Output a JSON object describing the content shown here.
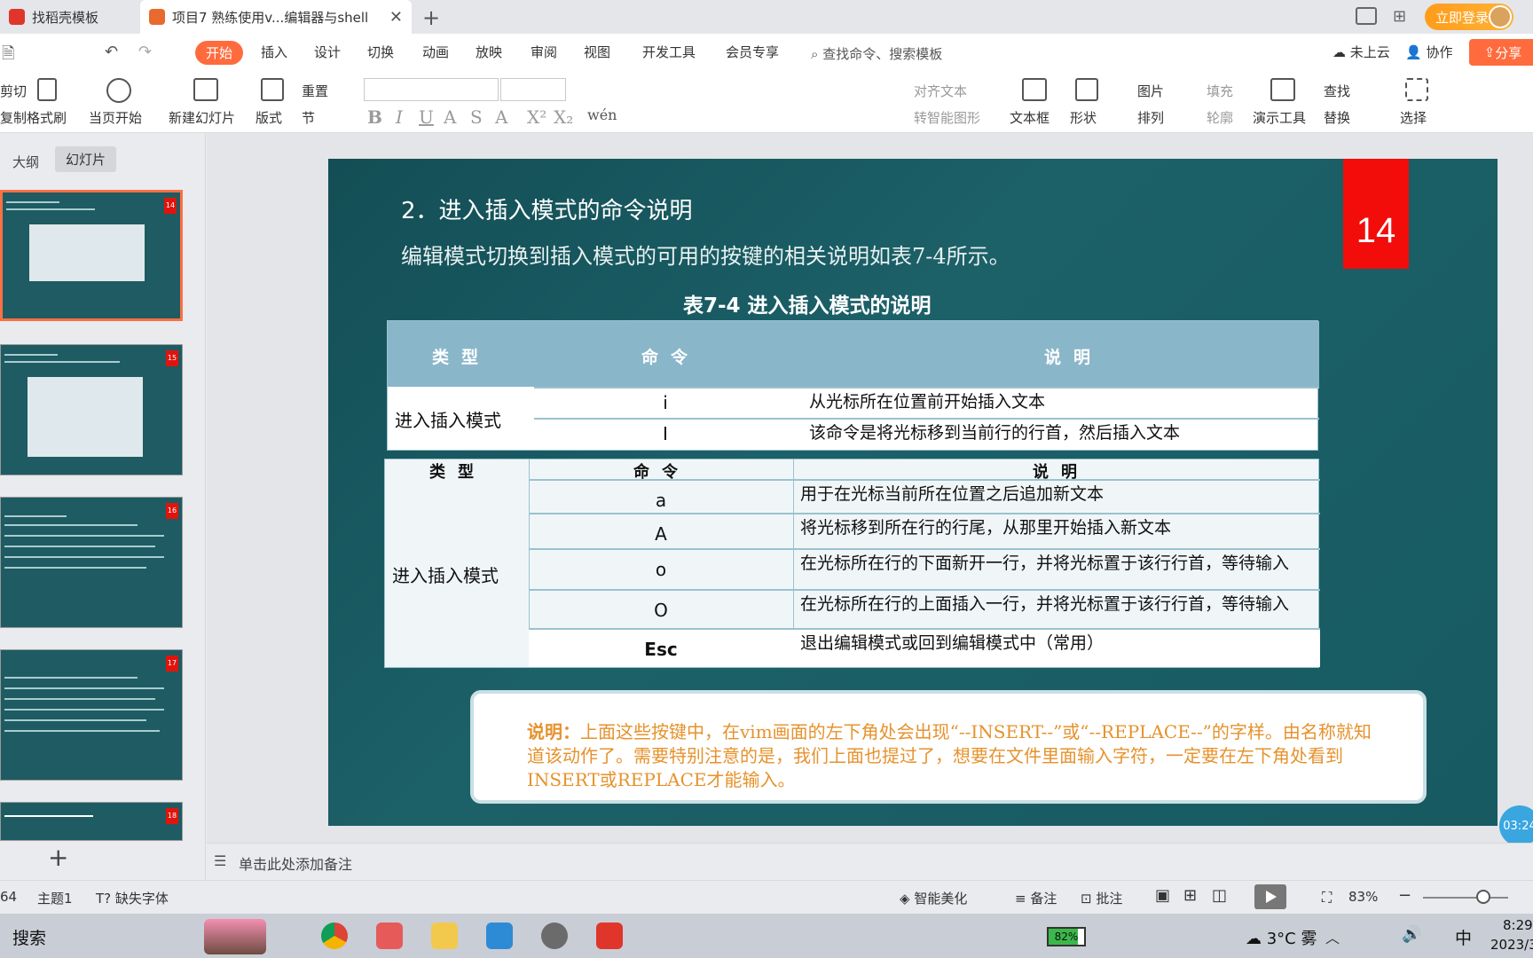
{
  "tabs": [
    {
      "label": "找稻壳模板"
    },
    {
      "label": "项目7 熟练使用v...编辑器与shell"
    }
  ],
  "header": {
    "login": "立即登录"
  },
  "menu": {
    "items": [
      "开始",
      "插入",
      "设计",
      "切换",
      "动画",
      "放映",
      "审阅",
      "视图",
      "开发工具",
      "会员专享"
    ],
    "search": "查找命令、搜索模板",
    "cloud": "未上云",
    "collab": "协作",
    "share": "分享"
  },
  "toolbar": {
    "cut": "剪切",
    "copy": "复制",
    "format_painter": "格式刷",
    "from_current": "当页开始",
    "new_slide": "新建幻灯片",
    "layout": "版式",
    "reset": "重置",
    "section": "节",
    "align_text": "对齐文本",
    "convert_smartart": "转智能图形",
    "textbox": "文本框",
    "shape": "形状",
    "picture": "图片",
    "arrange": "排列",
    "fill": "填充",
    "outline": "轮廓",
    "present_tools": "演示工具",
    "find": "查找",
    "replace": "替换",
    "select": "选择"
  },
  "left_panel": {
    "tab_outline": "大纲",
    "tab_slides": "幻灯片",
    "thumbs": [
      "14",
      "15",
      "16",
      "17",
      "18"
    ]
  },
  "slide": {
    "number": "14",
    "heading": "2．进入插入模式的命令说明",
    "intro": "编辑模式切换到插入模式的可用的按键的相关说明如表7-4所示。",
    "table_caption": "表7-4  进入插入模式的说明",
    "table1": {
      "headers": [
        "类型",
        "命令",
        "说明"
      ],
      "type": "进入插入模式",
      "rows": [
        {
          "cmd": "i",
          "desc": "从光标所在位置前开始插入文本"
        },
        {
          "cmd": "I",
          "desc": "该命令是将光标移到当前行的行首，然后插入文本"
        }
      ]
    },
    "table2": {
      "headers": [
        "类型",
        "命令",
        "说明"
      ],
      "type": "进入插入模式",
      "rows": [
        {
          "cmd": "a",
          "desc": "用于在光标当前所在位置之后追加新文本"
        },
        {
          "cmd": "A",
          "desc": "将光标移到所在行的行尾，从那里开始插入新文本"
        },
        {
          "cmd": "o",
          "desc": "在光标所在行的下面新开一行，并将光标置于该行行首，等待输入"
        },
        {
          "cmd": "O",
          "desc": "在光标所在行的上面插入一行，并将光标置于该行行首，等待输入"
        },
        {
          "cmd": "Esc",
          "desc": "退出编辑模式或回到编辑模式中（常用）"
        }
      ]
    },
    "note_label": "说明：",
    "note_text": "上面这些按键中，在vim画面的左下角处会出现“--INSERT--”或“--REPLACE--”的字样。由名称就知道该动作了。需要特别注意的是，我们上面也提过了，想要在文件里面输入字符，一定要在左下角处看到INSERT或REPLACE才能输入。"
  },
  "timer": "03:24",
  "notes_placeholder": "单击此处添加备注",
  "status": {
    "slide_count": "64",
    "theme": "主题1",
    "missing_font": "缺失字体",
    "beautify": "智能美化",
    "notes": "备注",
    "comments": "批注",
    "zoom": "83%"
  },
  "taskbar": {
    "search": "搜索",
    "battery": "82%",
    "weather": "3°C 雾",
    "ime": "中",
    "time": "8:29",
    "date": "2023/3"
  },
  "colors": {
    "accent": "#ff6b3d",
    "slide_bg": "#1c6068",
    "badge": "#f20d0a",
    "table_header": "#8ab6ca",
    "note_text": "#e6922c"
  }
}
